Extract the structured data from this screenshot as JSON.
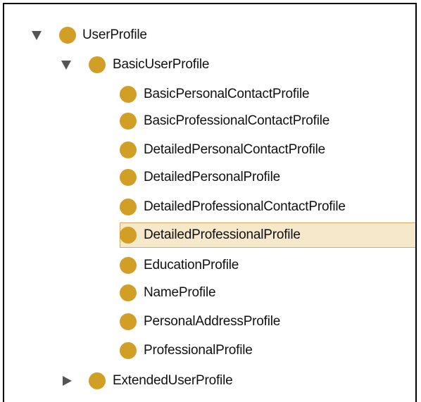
{
  "tree": {
    "root": {
      "label": "UserProfile",
      "expanded": true,
      "icon": "class-circle-icon"
    },
    "basic": {
      "label": "BasicUserProfile",
      "expanded": true,
      "icon": "class-circle-icon",
      "children": [
        "BasicPersonalContactProfile",
        "BasicProfessionalContactProfile",
        "DetailedPersonalContactProfile",
        "DetailedPersonalProfile",
        "DetailedProfessionalContactProfile",
        "DetailedProfessionalProfile",
        "EducationProfile",
        "NameProfile",
        "PersonalAddressProfile",
        "ProfessionalProfile"
      ],
      "selected_child": "DetailedProfessionalProfile"
    },
    "extended": {
      "label": "ExtendedUserProfile",
      "expanded": false,
      "icon": "class-circle-icon"
    }
  },
  "colors": {
    "node_icon": "#d19e26",
    "selection_fill": "#f6e8cb",
    "selection_border": "#d9a95f",
    "toggle_arrow": "#555555"
  }
}
